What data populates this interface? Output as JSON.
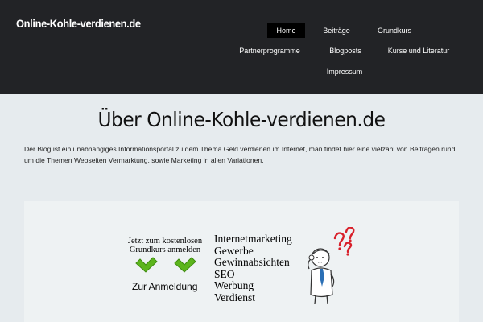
{
  "header": {
    "logo": "Online-Kohle-verdienen.de"
  },
  "nav": {
    "home": "Home",
    "beitraege": "Beiträge",
    "grundkurs": "Grundkurs",
    "partner": "Partnerprogramme",
    "blogposts": "Blogposts",
    "kurse": "Kurse und Literatur",
    "impressum": "Impressum",
    "active": "Home"
  },
  "main": {
    "title": "Über Online-Kohle-verdienen.de",
    "intro": "Der Blog ist ein unabhängiges Informationsportal zu dem Thema Geld verdienen im Internet, man findet hier eine vielzahl von Beiträgen rund um die Themen Webseiten Vermarktung, sowie Marketing in allen Variationen."
  },
  "banner": {
    "cta_line1": "Jetzt zum kostenlosen",
    "cta_line2": "Grundkurs anmelden",
    "cta_link": "Zur Anmeldung",
    "topics": [
      "Internetmarketing",
      "Gewerbe",
      "Gewinnabsichten",
      "SEO",
      "Werbung",
      "Verdienst"
    ],
    "colors": {
      "check_green": "#5cb51c",
      "question_red": "#d8202a",
      "tie_blue": "#2a6fb5"
    },
    "icons": [
      "check-icon",
      "check-icon",
      "thinking-person-illustration",
      "question-marks-icon"
    ]
  }
}
